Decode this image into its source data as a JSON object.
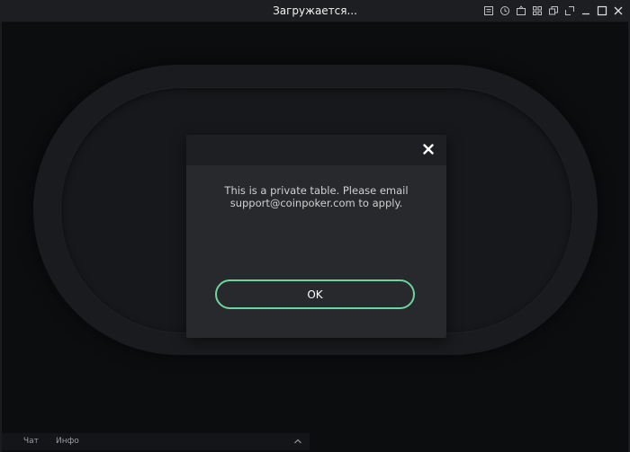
{
  "window": {
    "title": "Загружается..."
  },
  "toolbar_icons": [
    "note-icon",
    "history-icon",
    "lobby-icon",
    "grid-icon",
    "tables-icon",
    "resize-icon",
    "minimize-icon",
    "maximize-icon",
    "close-window-icon"
  ],
  "modal": {
    "message_line1": "This is a private table. Please email",
    "message_line2": "support@coinpoker.com to apply.",
    "ok_label": "OK",
    "accent_color": "#6fd39e"
  },
  "bottom_tabs": {
    "chat": "Чат",
    "info": "Инфо"
  }
}
